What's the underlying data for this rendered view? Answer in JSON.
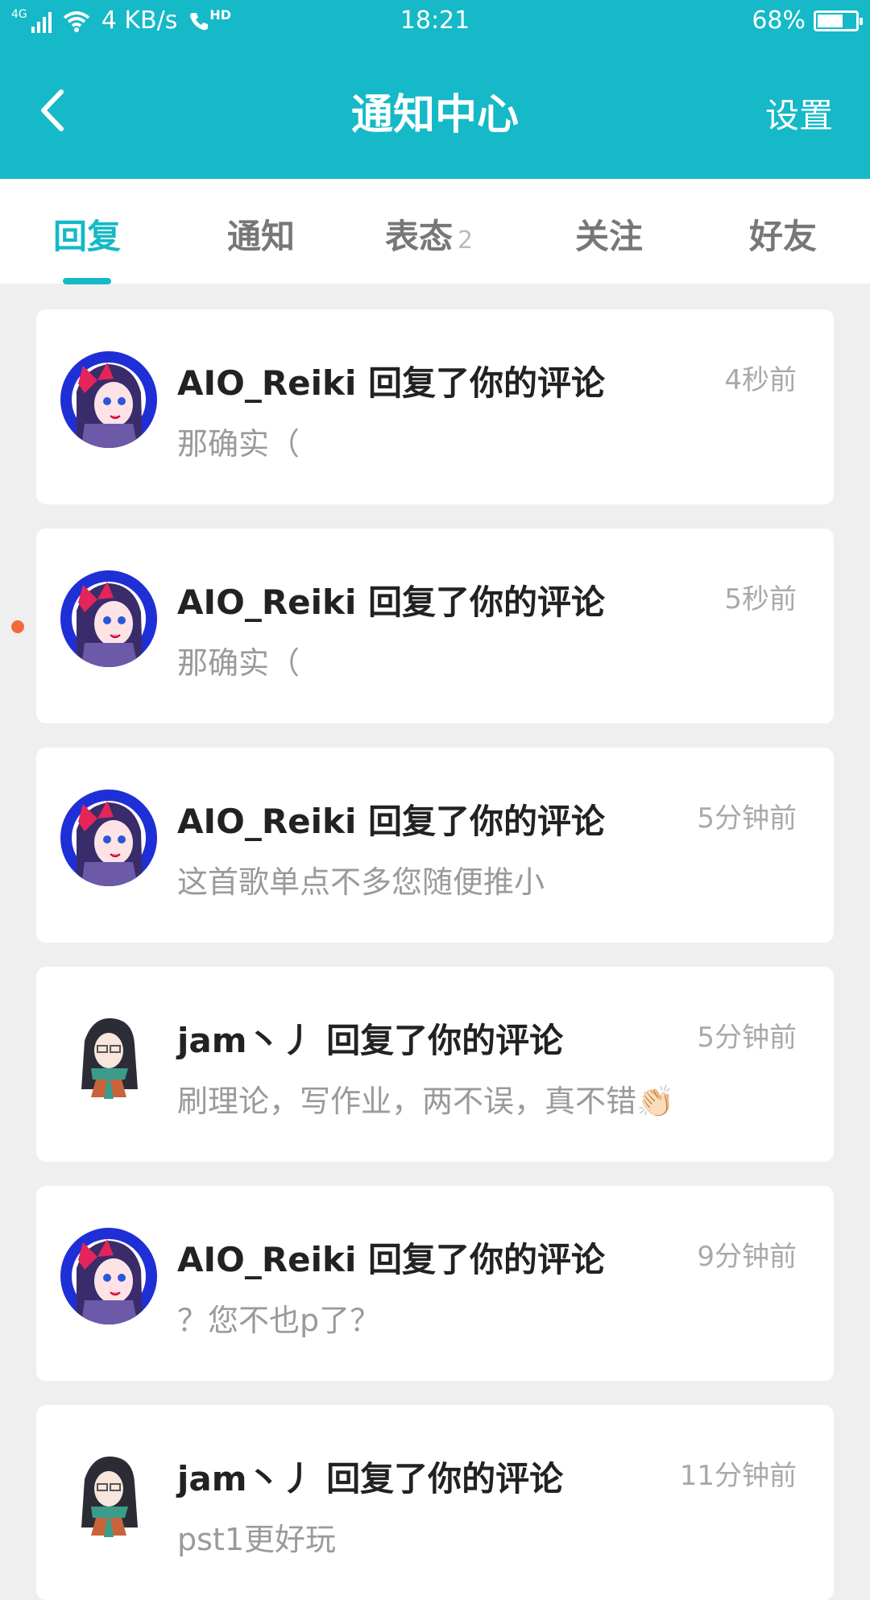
{
  "status_bar": {
    "network_type": "4G",
    "speed": "4 KB/s",
    "call_label": "HD",
    "time": "18:21",
    "battery_percent_text": "68%",
    "battery_level": 0.68
  },
  "header": {
    "title": "通知中心",
    "settings_label": "设置",
    "back_icon": "chevron-left-icon"
  },
  "tabs": [
    {
      "label": "回复",
      "active": true
    },
    {
      "label": "通知",
      "active": false
    },
    {
      "label": "表态",
      "count": "2",
      "active": false
    },
    {
      "label": "关注",
      "active": false
    },
    {
      "label": "好友",
      "active": false
    }
  ],
  "notifications": [
    {
      "title": "AIO_Reiki 回复了你的评论",
      "time": "4秒前",
      "body": "那确实（",
      "avatar": "anime-girl-blue-avatar"
    },
    {
      "title": "AIO_Reiki 回复了你的评论",
      "time": "5秒前",
      "body": "那确实（",
      "avatar": "anime-girl-blue-avatar",
      "unread": true
    },
    {
      "title": "AIO_Reiki 回复了你的评论",
      "time": "5分钟前",
      "body": "这首歌单点不多您随便推小",
      "avatar": "anime-girl-blue-avatar"
    },
    {
      "title": "jam丶丿 回复了你的评论",
      "time": "5分钟前",
      "body": "刷理论，写作业，两不误，真不错👏🏻",
      "avatar": "anime-girl-scarf-avatar"
    },
    {
      "title": "AIO_Reiki 回复了你的评论",
      "time": "9分钟前",
      "body": "？您不也p了？",
      "avatar": "anime-girl-blue-avatar"
    },
    {
      "title": "jam丶丿 回复了你的评论",
      "time": "11分钟前",
      "body": "pst1更好玩",
      "avatar": "anime-girl-scarf-avatar"
    }
  ],
  "colors": {
    "accent": "#15b9c7",
    "unread_dot": "#f26a3c",
    "background": "#efefef"
  }
}
